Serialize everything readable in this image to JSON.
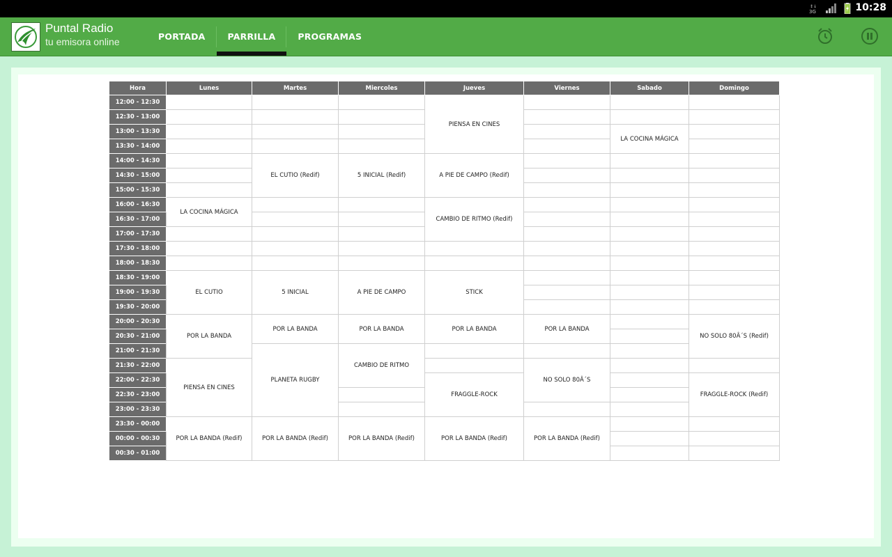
{
  "status_bar": {
    "time": "10:28",
    "icons": [
      "network-3g-icon",
      "signal-icon",
      "battery-icon"
    ]
  },
  "app": {
    "title": "Puntal Radio",
    "subtitle": "tu emisora online"
  },
  "tabs": [
    {
      "label": "PORTADA",
      "selected": false
    },
    {
      "label": "PARRILLA",
      "selected": true
    },
    {
      "label": "PROGRAMAS",
      "selected": false
    }
  ],
  "actions": {
    "alarm_icon": "alarm-clock-icon",
    "pause_icon": "pause-icon"
  },
  "colors": {
    "appbar": "#52ab47",
    "background": "#c6f2d6",
    "header_cell": "#6b6b6b"
  },
  "schedule": {
    "headers": [
      "Hora",
      "Lunes",
      "Martes",
      "Miercoles",
      "Jueves",
      "Viernes",
      "Sabado",
      "Domingo"
    ],
    "slots": [
      "12:00 - 12:30",
      "12:30 - 13:00",
      "13:00 - 13:30",
      "13:30 - 14:00",
      "14:00 - 14:30",
      "14:30 - 15:00",
      "15:00 - 15:30",
      "16:00 - 16:30",
      "16:30 - 17:00",
      "17:00 - 17:30",
      "17:30 - 18:00",
      "18:00 - 18:30",
      "18:30 - 19:00",
      "19:00 - 19:30",
      "19:30 - 20:00",
      "20:00 - 20:30",
      "20:30 - 21:00",
      "21:00 - 21:30",
      "21:30 - 22:00",
      "22:00 - 22:30",
      "22:30 - 23:00",
      "23:00 - 23:30",
      "23:30 - 00:00",
      "00:00 - 00:30",
      "00:30 - 01:00"
    ],
    "days": [
      [
        [
          0,
          7,
          ""
        ],
        [
          7,
          2,
          "LA COCINA MÁGICA"
        ],
        [
          9,
          3,
          ""
        ],
        [
          12,
          3,
          "EL CUTIO"
        ],
        [
          15,
          3,
          "POR LA BANDA"
        ],
        [
          18,
          4,
          "PIENSA EN CINES"
        ],
        [
          22,
          3,
          "POR LA BANDA (Redif)"
        ]
      ],
      [
        [
          0,
          4,
          ""
        ],
        [
          4,
          3,
          "EL CUTIO (Redif)"
        ],
        [
          7,
          5,
          ""
        ],
        [
          12,
          3,
          "5 INICIAL"
        ],
        [
          15,
          2,
          "POR LA BANDA"
        ],
        [
          17,
          5,
          "PLANETA RUGBY"
        ],
        [
          22,
          3,
          "POR LA BANDA (Redif)"
        ]
      ],
      [
        [
          0,
          4,
          ""
        ],
        [
          4,
          3,
          "5 INICIAL (Redif)"
        ],
        [
          7,
          5,
          ""
        ],
        [
          12,
          3,
          "A PIE DE CAMPO"
        ],
        [
          15,
          2,
          "POR LA BANDA"
        ],
        [
          17,
          3,
          "CAMBIO DE RITMO"
        ],
        [
          20,
          2,
          ""
        ],
        [
          22,
          3,
          "POR LA BANDA (Redif)"
        ]
      ],
      [
        [
          0,
          4,
          "PIENSA EN CINES"
        ],
        [
          4,
          3,
          "A PIE DE CAMPO (Redif)"
        ],
        [
          7,
          3,
          "CAMBIO DE RITMO (Redif)"
        ],
        [
          10,
          2,
          ""
        ],
        [
          12,
          3,
          "STICK"
        ],
        [
          15,
          2,
          "POR LA BANDA"
        ],
        [
          17,
          2,
          ""
        ],
        [
          19,
          3,
          "FRAGGLE-ROCK"
        ],
        [
          22,
          3,
          "POR LA BANDA (Redif)"
        ]
      ],
      [
        [
          0,
          15,
          ""
        ],
        [
          15,
          2,
          "POR LA BANDA"
        ],
        [
          17,
          1,
          ""
        ],
        [
          18,
          3,
          "NO SOLO 80Â´S"
        ],
        [
          21,
          1,
          ""
        ],
        [
          22,
          3,
          "POR LA BANDA (Redif)"
        ]
      ],
      [
        [
          0,
          2,
          ""
        ],
        [
          2,
          2,
          "LA COCINA MÁGICA"
        ],
        [
          4,
          21,
          ""
        ]
      ],
      [
        [
          0,
          15,
          ""
        ],
        [
          15,
          3,
          "NO SOLO 80Â´S (Redif)"
        ],
        [
          18,
          1,
          ""
        ],
        [
          19,
          3,
          "FRAGGLE-ROCK (Redif)"
        ],
        [
          22,
          3,
          ""
        ]
      ]
    ]
  }
}
